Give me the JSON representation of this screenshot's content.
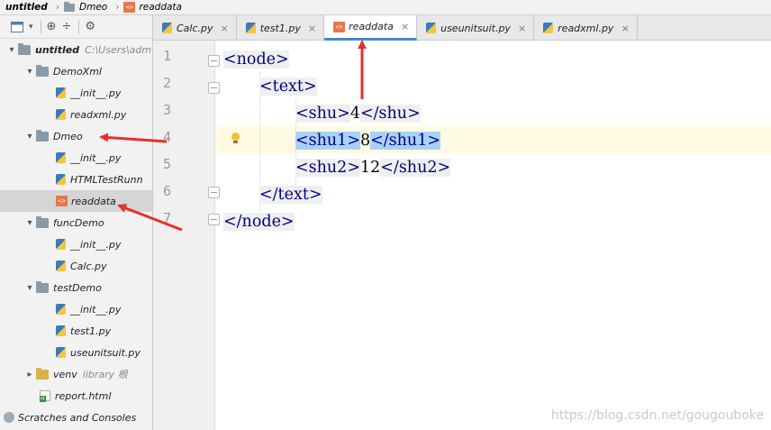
{
  "breadcrumb": {
    "project": "untitled",
    "folder": "Dmeo",
    "file": "readdata"
  },
  "project_panel": {
    "toolbar_icons": [
      "project-view-icon",
      "dropdown-icon",
      "locate-icon",
      "collapse-icon",
      "gear-icon"
    ],
    "tree": [
      {
        "label": "untitled",
        "note": "C:\\Users\\adm",
        "type": "root",
        "expanded": true,
        "depth": 0
      },
      {
        "label": "DemoXml",
        "type": "folder",
        "expanded": true,
        "depth": 1
      },
      {
        "label": "__init__.py",
        "type": "py",
        "depth": 2
      },
      {
        "label": "readxml.py",
        "type": "py",
        "depth": 2
      },
      {
        "label": "Dmeo",
        "type": "folder",
        "expanded": true,
        "depth": 1
      },
      {
        "label": "__init__.py",
        "type": "py",
        "depth": 2
      },
      {
        "label": "HTMLTestRunn",
        "type": "py",
        "depth": 2
      },
      {
        "label": "readdata",
        "type": "xml",
        "depth": 2,
        "selected": true
      },
      {
        "label": "funcDemo",
        "type": "folder",
        "expanded": true,
        "depth": 1
      },
      {
        "label": "__init__.py",
        "type": "py",
        "depth": 2
      },
      {
        "label": "Calc.py",
        "type": "py",
        "depth": 2
      },
      {
        "label": "testDemo",
        "type": "folder",
        "expanded": true,
        "depth": 1
      },
      {
        "label": "__init__.py",
        "type": "py",
        "depth": 2
      },
      {
        "label": "test1.py",
        "type": "py",
        "depth": 2
      },
      {
        "label": "useunitsuit.py",
        "type": "py",
        "depth": 2
      },
      {
        "label": "venv",
        "note": "library 根",
        "type": "venv",
        "expanded": false,
        "depth": 1
      },
      {
        "label": "report.html",
        "type": "html",
        "depth": 1
      },
      {
        "label": "Scratches and Consoles",
        "type": "scratch",
        "depth": 0
      }
    ]
  },
  "tabs": [
    {
      "label": "Calc.py",
      "icon": "python-file-icon",
      "active": false
    },
    {
      "label": "test1.py",
      "icon": "python-file-icon",
      "active": false
    },
    {
      "label": "readdata",
      "icon": "xml-file-icon",
      "active": true
    },
    {
      "label": "useunitsuit.py",
      "icon": "python-file-icon",
      "active": false
    },
    {
      "label": "readxml.py",
      "icon": "python-file-icon",
      "active": false
    }
  ],
  "tab_close_glyph": "×",
  "editor": {
    "line_numbers": [
      "1",
      "2",
      "3",
      "4",
      "5",
      "6",
      "7"
    ],
    "lines": [
      {
        "indent": 0,
        "parts": [
          {
            "t": "tag",
            "v": "<node>"
          }
        ]
      },
      {
        "indent": 1,
        "parts": [
          {
            "t": "tag",
            "v": "<text>"
          }
        ]
      },
      {
        "indent": 2,
        "parts": [
          {
            "t": "tag",
            "v": "<shu>"
          },
          {
            "t": "txt",
            "v": "4"
          },
          {
            "t": "tag",
            "v": "</shu>"
          }
        ]
      },
      {
        "indent": 2,
        "parts": [
          {
            "t": "taghl",
            "v": "<shu1>"
          },
          {
            "t": "txt",
            "v": "8"
          },
          {
            "t": "taghl",
            "v": "</shu1>"
          }
        ],
        "current": true
      },
      {
        "indent": 2,
        "parts": [
          {
            "t": "tag",
            "v": "<shu2>"
          },
          {
            "t": "txt",
            "v": "12"
          },
          {
            "t": "tag",
            "v": "</shu2>"
          }
        ]
      },
      {
        "indent": 1,
        "parts": [
          {
            "t": "tag",
            "v": "</text>"
          }
        ]
      },
      {
        "indent": 0,
        "parts": [
          {
            "t": "tag",
            "v": "</node>"
          }
        ]
      }
    ]
  },
  "watermark": "https://blog.csdn.net/gougouboke",
  "colors": {
    "annotation_arrow": "#e53030",
    "active_tab_underline": "#4a86c8",
    "tag_text": "#000080",
    "tag_highlight": "#a9d1f7"
  }
}
